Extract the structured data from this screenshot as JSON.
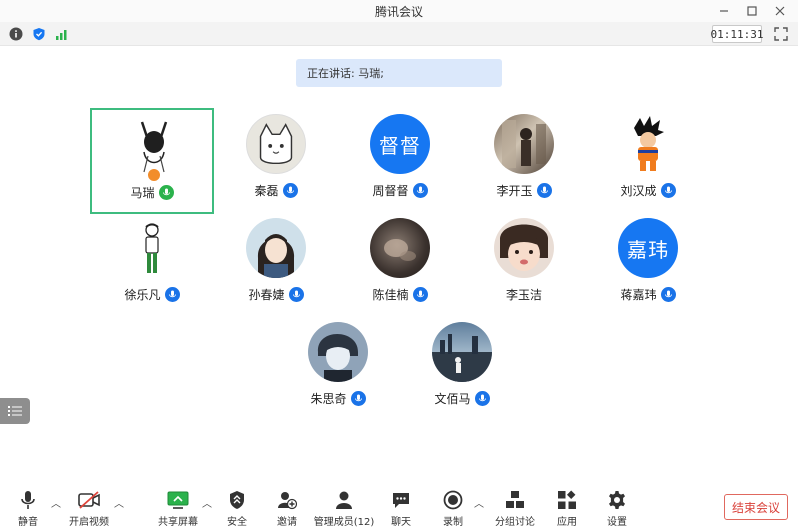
{
  "window": {
    "title": "腾讯会议"
  },
  "status": {
    "timer": "01:11:31"
  },
  "banner": {
    "speaking": "正在讲话: 马瑞;"
  },
  "participants": [
    {
      "name": "马瑞",
      "avatar": "sketch-figure",
      "active": true,
      "host": true
    },
    {
      "name": "秦磊",
      "avatar": "cartoon-cat"
    },
    {
      "name": "周督督",
      "avatar_text": "督督"
    },
    {
      "name": "李开玉",
      "avatar": "photo"
    },
    {
      "name": "刘汉成",
      "avatar": "anime-character"
    },
    {
      "name": "徐乐凡",
      "avatar": "chibi-figure"
    },
    {
      "name": "孙春婕",
      "avatar": "anime-girl"
    },
    {
      "name": "陈佳楠",
      "avatar": "photo-dark"
    },
    {
      "name": "李玉洁",
      "avatar": "photo-child"
    },
    {
      "name": "蒋嘉玮",
      "avatar_text": "嘉玮"
    },
    {
      "name": "朱思奇",
      "avatar": "anime-boy"
    },
    {
      "name": "文佰马",
      "avatar": "photo-city"
    }
  ],
  "toolbar": {
    "mute": "静音",
    "video": "开启视频",
    "share": "共享屏幕",
    "security": "安全",
    "invite": "邀请",
    "members": "管理成员(12)",
    "chat": "聊天",
    "record": "录制",
    "breakout": "分组讨论",
    "apps": "应用",
    "settings": "设置",
    "end": "结束会议"
  },
  "colors": {
    "accent": "#1677f2",
    "active_border": "#3ebc7f",
    "end": "#d9413a",
    "banner": "#dbe8fb"
  }
}
